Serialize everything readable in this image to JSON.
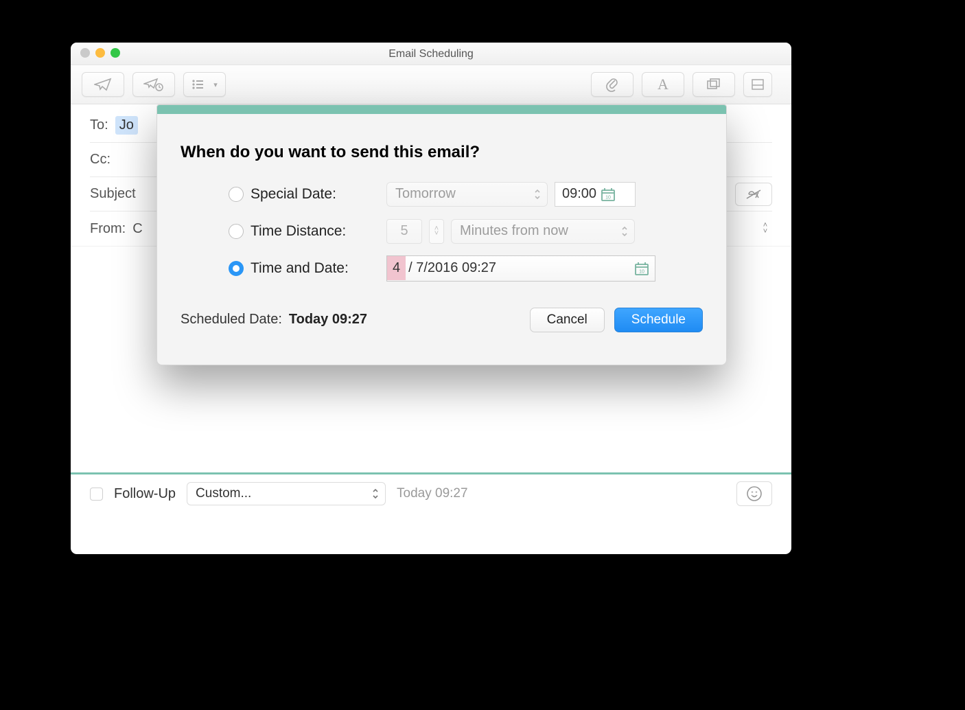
{
  "window": {
    "title": "Email Scheduling"
  },
  "compose": {
    "to_label": "To:",
    "to_value": "Jo",
    "cc_label": "Cc:",
    "subject_label": "Subject",
    "from_label": "From:",
    "from_value": "C"
  },
  "footer": {
    "followup_label": "Follow-Up",
    "select_value": "Custom...",
    "time_text": "Today 09:27"
  },
  "modal": {
    "heading": "When do you want to send this email?",
    "opt1_label": "Special Date:",
    "opt1_select": "Tomorrow",
    "opt1_time": "09:00",
    "opt2_label": "Time Distance:",
    "opt2_value": "5",
    "opt2_units": "Minutes from now",
    "opt3_label": "Time and Date:",
    "opt3_seg1": "4",
    "opt3_rest": "/  7/2016 09:27",
    "summary_label": "Scheduled Date:",
    "summary_value": "Today 09:27",
    "cancel": "Cancel",
    "schedule": "Schedule",
    "selected": "time_and_date"
  }
}
